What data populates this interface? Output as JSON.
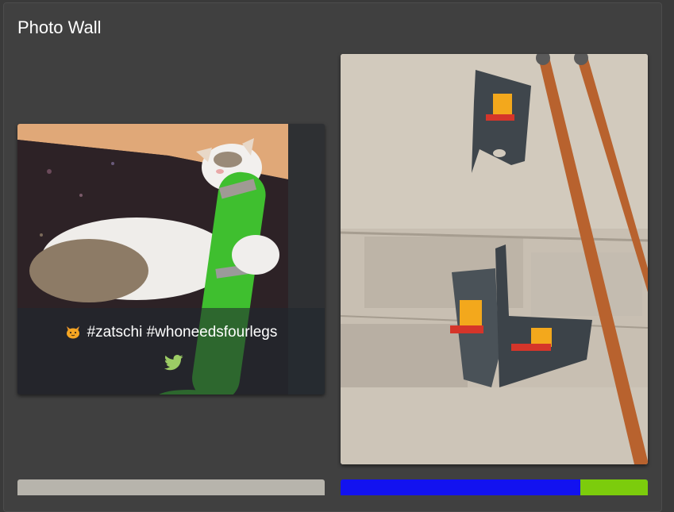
{
  "page": {
    "title": "Photo Wall"
  },
  "posts": [
    {
      "caption": "#zatschi #whoneedsfourlegs",
      "caption_emoji_icon": "cat-face-icon",
      "source_icon": "twitter-icon"
    }
  ],
  "colors": {
    "background": "#404040",
    "title": "#ffffff",
    "twitter": "#9ccc65"
  }
}
